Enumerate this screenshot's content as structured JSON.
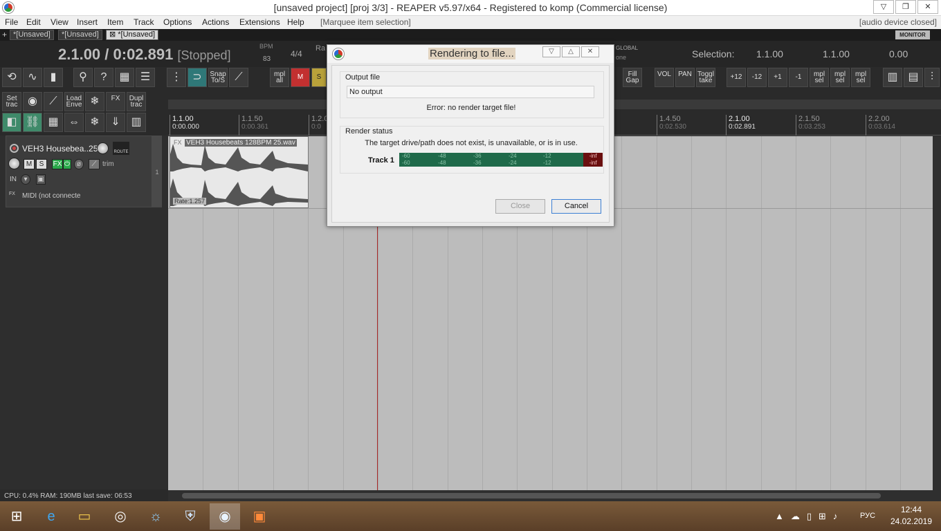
{
  "window": {
    "title": "[unsaved project] [proj 3/3] - REAPER v5.97/x64 - Registered to komp (Commercial license)",
    "buttons": [
      "▽",
      "❐",
      "✕"
    ]
  },
  "menu": {
    "items": [
      "File",
      "Edit",
      "View",
      "Insert",
      "Item",
      "Track",
      "Options",
      "Actions",
      "Extensions",
      "Help"
    ],
    "marquee": "[Marquee item selection]",
    "audio_status": "[audio device closed]"
  },
  "tabs": {
    "plus": "+",
    "items": [
      "*[Unsaved]",
      "*[Unsaved]",
      "⊠ *[Unsaved]"
    ],
    "monitor_fx": "MONITOR FX"
  },
  "transport": {
    "time": "2.1.00 / 0:02.891",
    "state": "[Stopped]",
    "bpm_label": "BPM",
    "bpm_value": "83",
    "time_signature": "4/4",
    "rate_label": "Ra",
    "global_label": "GLOBAL",
    "none_label": "one",
    "selection_label": "Selection:",
    "selection_start": "1.1.00",
    "selection_end": "1.1.00",
    "selection_length": "0.00"
  },
  "toolbar": {
    "snap": "Snap To/S",
    "mpl_all": "mpl all",
    "fill_gap": "Fill Gap",
    "vol": "VOL",
    "pan": "PAN",
    "toggle_take": "Toggl take",
    "plus12": "+12",
    "minus12": "-12",
    "plus1": "+1",
    "minus1": "-1",
    "mpl_sel": "mpl sel",
    "set_track": "Set trac",
    "load_env": "Load Enve",
    "fx": "FX",
    "dupl_track": "Dupl trac",
    "m_label": "M",
    "s_label": "S"
  },
  "ruler": {
    "marks": [
      {
        "bar": "1.1.00",
        "time": "0:00.000",
        "strong": true
      },
      {
        "bar": "1.1.50",
        "time": "0:00.361",
        "strong": false
      },
      {
        "bar": "1.2.0",
        "time": "0:0",
        "strong": false
      },
      {
        "bar": "1.4.50",
        "time": "0:02.530",
        "strong": false
      },
      {
        "bar": "2.1.00",
        "time": "0:02.891",
        "strong": true
      },
      {
        "bar": "2.1.50",
        "time": "0:03.253",
        "strong": false
      },
      {
        "bar": "2.2.00",
        "time": "0:03.614",
        "strong": false
      }
    ]
  },
  "track": {
    "name": "VEH3 Housebea..25",
    "number": "1",
    "route": "ROUTE",
    "mute": "M",
    "solo": "S",
    "fx": "FX",
    "trim": "trim",
    "in": "IN",
    "midi": "MIDI (not connecte"
  },
  "item": {
    "fx": "FX",
    "name": "VEH3 Housebeats 128BPM 25.wav",
    "rate": "Rate:1.257"
  },
  "status_bar": {
    "text": "CPU: 0.4% RAM: 190MB last save: 06:53"
  },
  "render_dialog": {
    "title": "Rendering to file...",
    "output_group": "Output file",
    "output_value": "No output",
    "error": "Error: no render target file!",
    "status_group": "Render status",
    "status_text": "The target drive/path does not exist, is unavailable, or is in use.",
    "track_label": "Track 1",
    "meter_scale": [
      "-60",
      "-48",
      "-36",
      "-24",
      "-12"
    ],
    "peak": "-inf",
    "close_button": "Close",
    "cancel_button": "Cancel"
  },
  "taskbar": {
    "time": "12:44",
    "date": "24.02.2019",
    "language": "РУС"
  },
  "colors": {
    "meter_green": "#1f6a4a",
    "meter_peak": "#6a0f0f",
    "cursor_red": "#a82828",
    "arrange_bg": "#bcbcbc"
  }
}
